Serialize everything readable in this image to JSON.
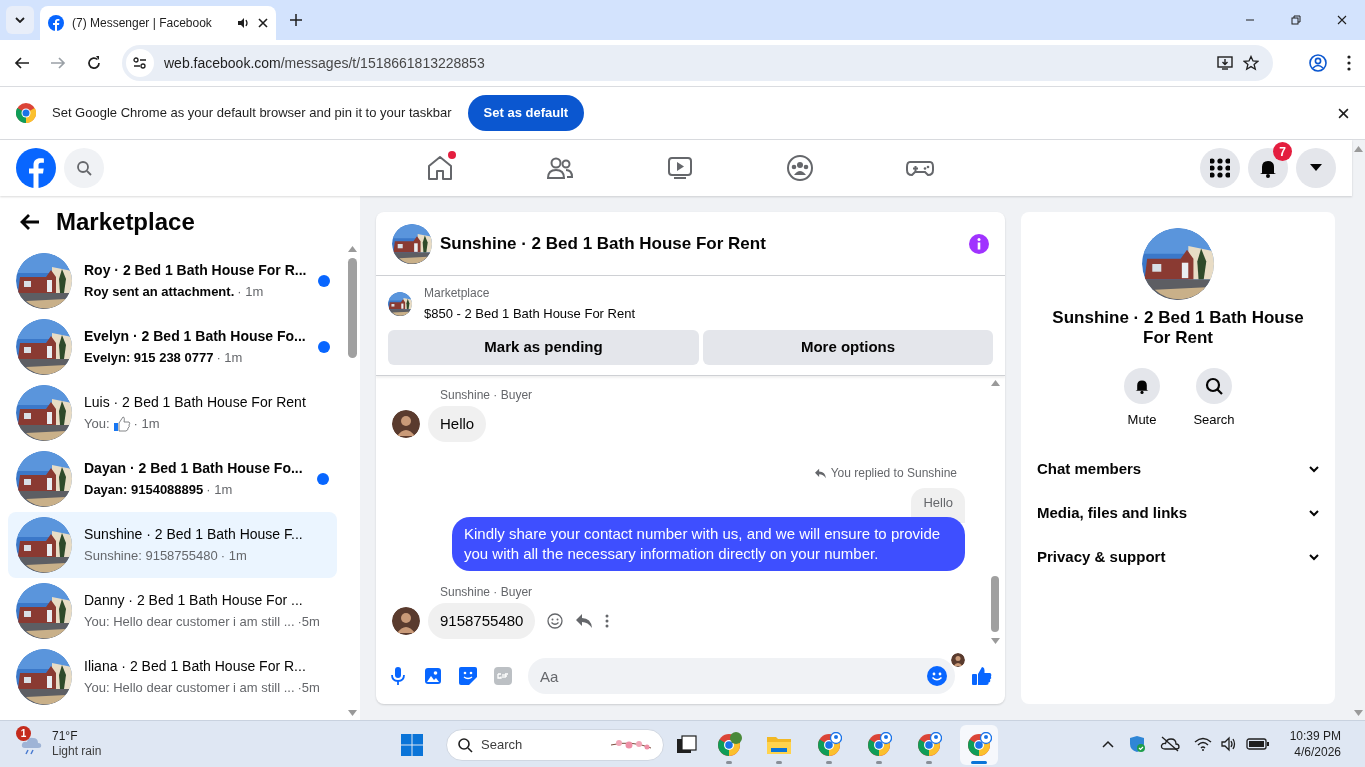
{
  "browser": {
    "tab_title": "(7) Messenger | Facebook",
    "url_host": "web.facebook.com",
    "url_path": "/messages/t/1518661813228853",
    "infobar": {
      "message": "Set Google Chrome as your default browser and pin it to your taskbar",
      "button": "Set as default"
    }
  },
  "nav": {
    "center": [
      {
        "kind": "home",
        "dot": true
      },
      {
        "kind": "friends",
        "dot": false
      },
      {
        "kind": "video",
        "dot": false
      },
      {
        "kind": "groups",
        "dot": false
      },
      {
        "kind": "gaming",
        "dot": false
      }
    ],
    "notifications_badge": "7"
  },
  "sidebar": {
    "title": "Marketplace",
    "conversations": [
      {
        "title": "Roy · 2 Bed 1 Bath House For R...",
        "preview": "Roy sent an attachment.",
        "kind": "text",
        "time": "· 1m",
        "unread": true,
        "selected": false
      },
      {
        "title": "Evelyn · 2 Bed 1 Bath House Fo...",
        "preview": "Evelyn: 915 238 0777",
        "kind": "text",
        "time": "· 1m",
        "unread": true,
        "selected": false
      },
      {
        "title": "Luis · 2 Bed 1 Bath House For Rent",
        "preview": "You:",
        "kind": "like",
        "time": "· 1m",
        "unread": false,
        "selected": false
      },
      {
        "title": "Dayan · 2 Bed 1 Bath House Fo...",
        "preview": "Dayan: 9154088895",
        "kind": "text",
        "time": "· 1m",
        "unread": true,
        "selected": false
      },
      {
        "title": "Sunshine · 2 Bed 1 Bath House F...",
        "preview": "Sunshine: 9158755480",
        "kind": "text",
        "time": "· 1m",
        "unread": false,
        "selected": true
      },
      {
        "title": "Danny · 2 Bed 1 Bath House For ...",
        "preview": "You: Hello dear customer i am still ...",
        "kind": "text",
        "time": "·5m",
        "unread": false,
        "selected": false
      },
      {
        "title": "Iliana · 2 Bed 1 Bath House For R...",
        "preview": "You: Hello dear customer i am still ...",
        "kind": "text",
        "time": "·5m",
        "unread": false,
        "selected": false
      }
    ]
  },
  "chat": {
    "title": "Sunshine · 2 Bed 1 Bath House For Rent",
    "listing": {
      "label": "Marketplace",
      "title": "$850 - 2 Bed 1 Bath House For Rent"
    },
    "buttons": [
      "Mark as pending",
      "More options"
    ],
    "messages": [
      {
        "kind": "incoming",
        "sender": "Sunshine · Buyer",
        "text": "Hello",
        "actions": false
      },
      {
        "kind": "reply_note",
        "text": "You replied to Sunshine"
      },
      {
        "kind": "quoted",
        "text": "Hello"
      },
      {
        "kind": "outgoing",
        "text": "Kindly share your contact number with us, and we will ensure to provide you with all the necessary information directly on your number."
      },
      {
        "kind": "incoming",
        "sender": "Sunshine · Buyer",
        "text": "9158755480",
        "actions": true
      }
    ],
    "composer": {
      "placeholder": "Aa"
    }
  },
  "details": {
    "title": "Sunshine · 2 Bed 1 Bath House For Rent",
    "actions": [
      {
        "kind": "mute",
        "label": "Mute"
      },
      {
        "kind": "search",
        "label": "Search"
      }
    ],
    "sections": [
      "Chat members",
      "Media, files and links",
      "Privacy & support"
    ]
  },
  "taskbar": {
    "weather": {
      "badge": "1",
      "temperature": "71°F",
      "condition": "Light rain"
    },
    "search_placeholder": "Search",
    "time": "10:39 PM",
    "date": "4/6/2026"
  }
}
